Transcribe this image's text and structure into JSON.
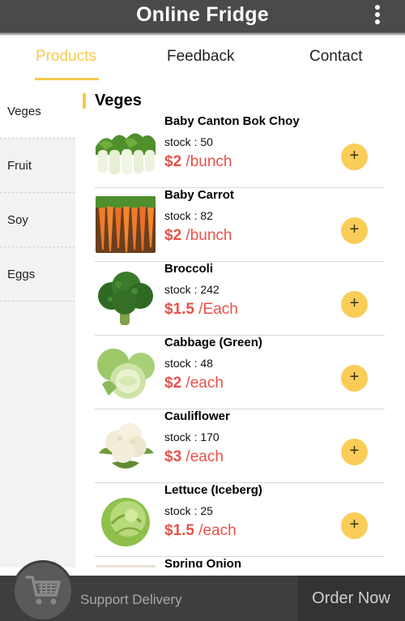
{
  "header": {
    "title": "Online Fridge"
  },
  "tabs": [
    {
      "label": "Products",
      "active": true
    },
    {
      "label": "Feedback",
      "active": false
    },
    {
      "label": "Contact",
      "active": false
    }
  ],
  "sidebar": {
    "items": [
      {
        "label": "Veges",
        "active": true
      },
      {
        "label": "Fruit",
        "active": false
      },
      {
        "label": "Soy",
        "active": false
      },
      {
        "label": "Eggs",
        "active": false
      }
    ]
  },
  "section": {
    "title": "Veges"
  },
  "products": [
    {
      "name": "Baby Canton Bok Choy",
      "stock": "stock : 50",
      "price": "$2",
      "unit": "/bunch",
      "image": "bok-choy-image"
    },
    {
      "name": "Baby Carrot",
      "stock": "stock : 82",
      "price": "$2",
      "unit": "/bunch",
      "image": "carrot-image"
    },
    {
      "name": "Broccoli",
      "stock": "stock : 242",
      "price": "$1.5",
      "unit": "/Each",
      "image": "broccoli-image"
    },
    {
      "name": "Cabbage (Green)",
      "stock": "stock : 48",
      "price": "$2",
      "unit": "/each",
      "image": "cabbage-image"
    },
    {
      "name": "Cauliflower",
      "stock": "stock : 170",
      "price": "$3",
      "unit": "/each",
      "image": "cauliflower-image"
    },
    {
      "name": "Lettuce (Iceberg)",
      "stock": "stock : 25",
      "price": "$1.5",
      "unit": "/each",
      "image": "lettuce-image"
    },
    {
      "name": "Spring Onion",
      "image": "spring-onion-image"
    }
  ],
  "add_label": "+",
  "bottom": {
    "support_label": "Support Delivery",
    "order_label": "Order Now",
    "cart_icon": "cart-icon"
  },
  "colors": {
    "accent": "#f7c94f",
    "price": "#e8514a",
    "header_bg": "#4a4a4a",
    "bottom_bg": "#3e3e3e"
  }
}
